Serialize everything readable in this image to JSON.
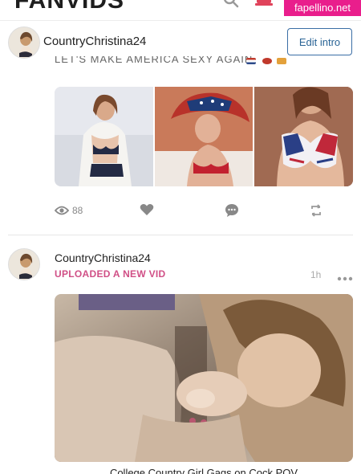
{
  "topbar": {
    "brand": "FANVIDS",
    "search_icon": "search-icon",
    "notification_icon": "bell-icon",
    "watermark": "fapellino.net"
  },
  "profile": {
    "name": "CountryChristina24",
    "edit_intro_label": "Edit intro",
    "avatar_icon": "avatar"
  },
  "post1": {
    "text_fragment": "LET'S MAKE AMERICA SEXY AGAIN",
    "views": "88",
    "icons": [
      "eye-icon",
      "heart-icon",
      "comment-icon",
      "repost-icon"
    ],
    "photo_count": 3
  },
  "post2": {
    "author": "CountryChristina24",
    "action": "UPLOADED A NEW VID",
    "time": "1h",
    "more_icon": "more-dots-icon",
    "video_title": "College Country Girl Gags on Cock POV"
  },
  "colors": {
    "accent_pink": "#d04f86",
    "watermark_bg": "#e91e8c",
    "button_blue": "#2a6496",
    "muted": "#888888"
  }
}
